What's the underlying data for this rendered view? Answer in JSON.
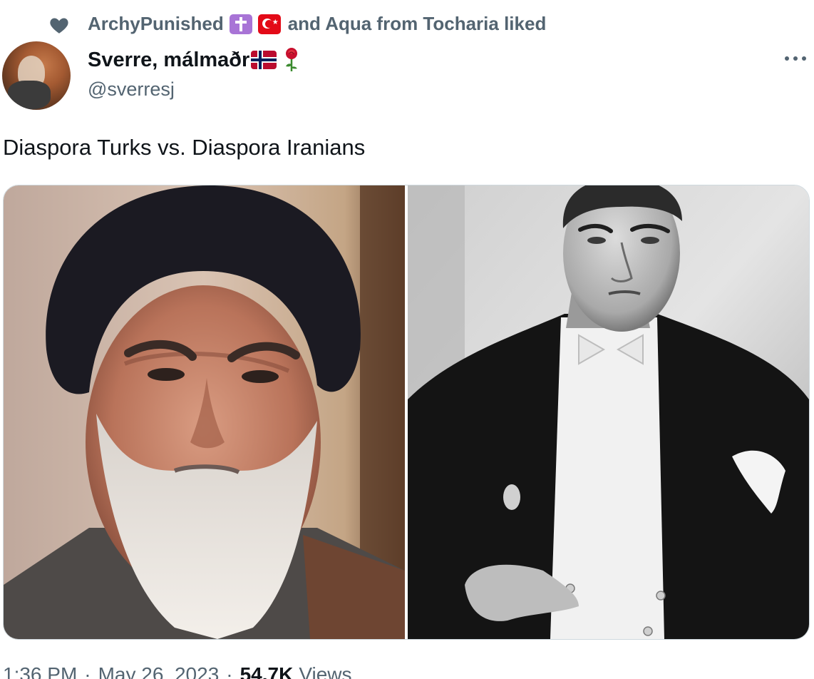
{
  "social_context": {
    "icon": "heart-icon",
    "user1": "ArchyPunished",
    "user1_emojis": [
      "latin-cross-emoji",
      "turkey-flag-emoji"
    ],
    "tail": "and Aqua from Tocharia liked"
  },
  "author": {
    "display_name": "Sverre, málmaðr",
    "name_emojis": [
      "norway-flag-emoji",
      "rose-emoji"
    ],
    "handle": "@sverresj"
  },
  "tweet": {
    "text": "Diaspora Turks vs. Diaspora Iranians"
  },
  "media": {
    "images": [
      {
        "name": "photo-cleric-color"
      },
      {
        "name": "photo-man-tuxedo-bw"
      }
    ]
  },
  "meta": {
    "time": "1:36 PM",
    "date": "May 26, 2023",
    "separator": "·",
    "views_count": "54.7K",
    "views_label": "Views"
  },
  "colors": {
    "text_primary": "#0f1419",
    "text_secondary": "#536471",
    "border": "#cfd9de"
  }
}
